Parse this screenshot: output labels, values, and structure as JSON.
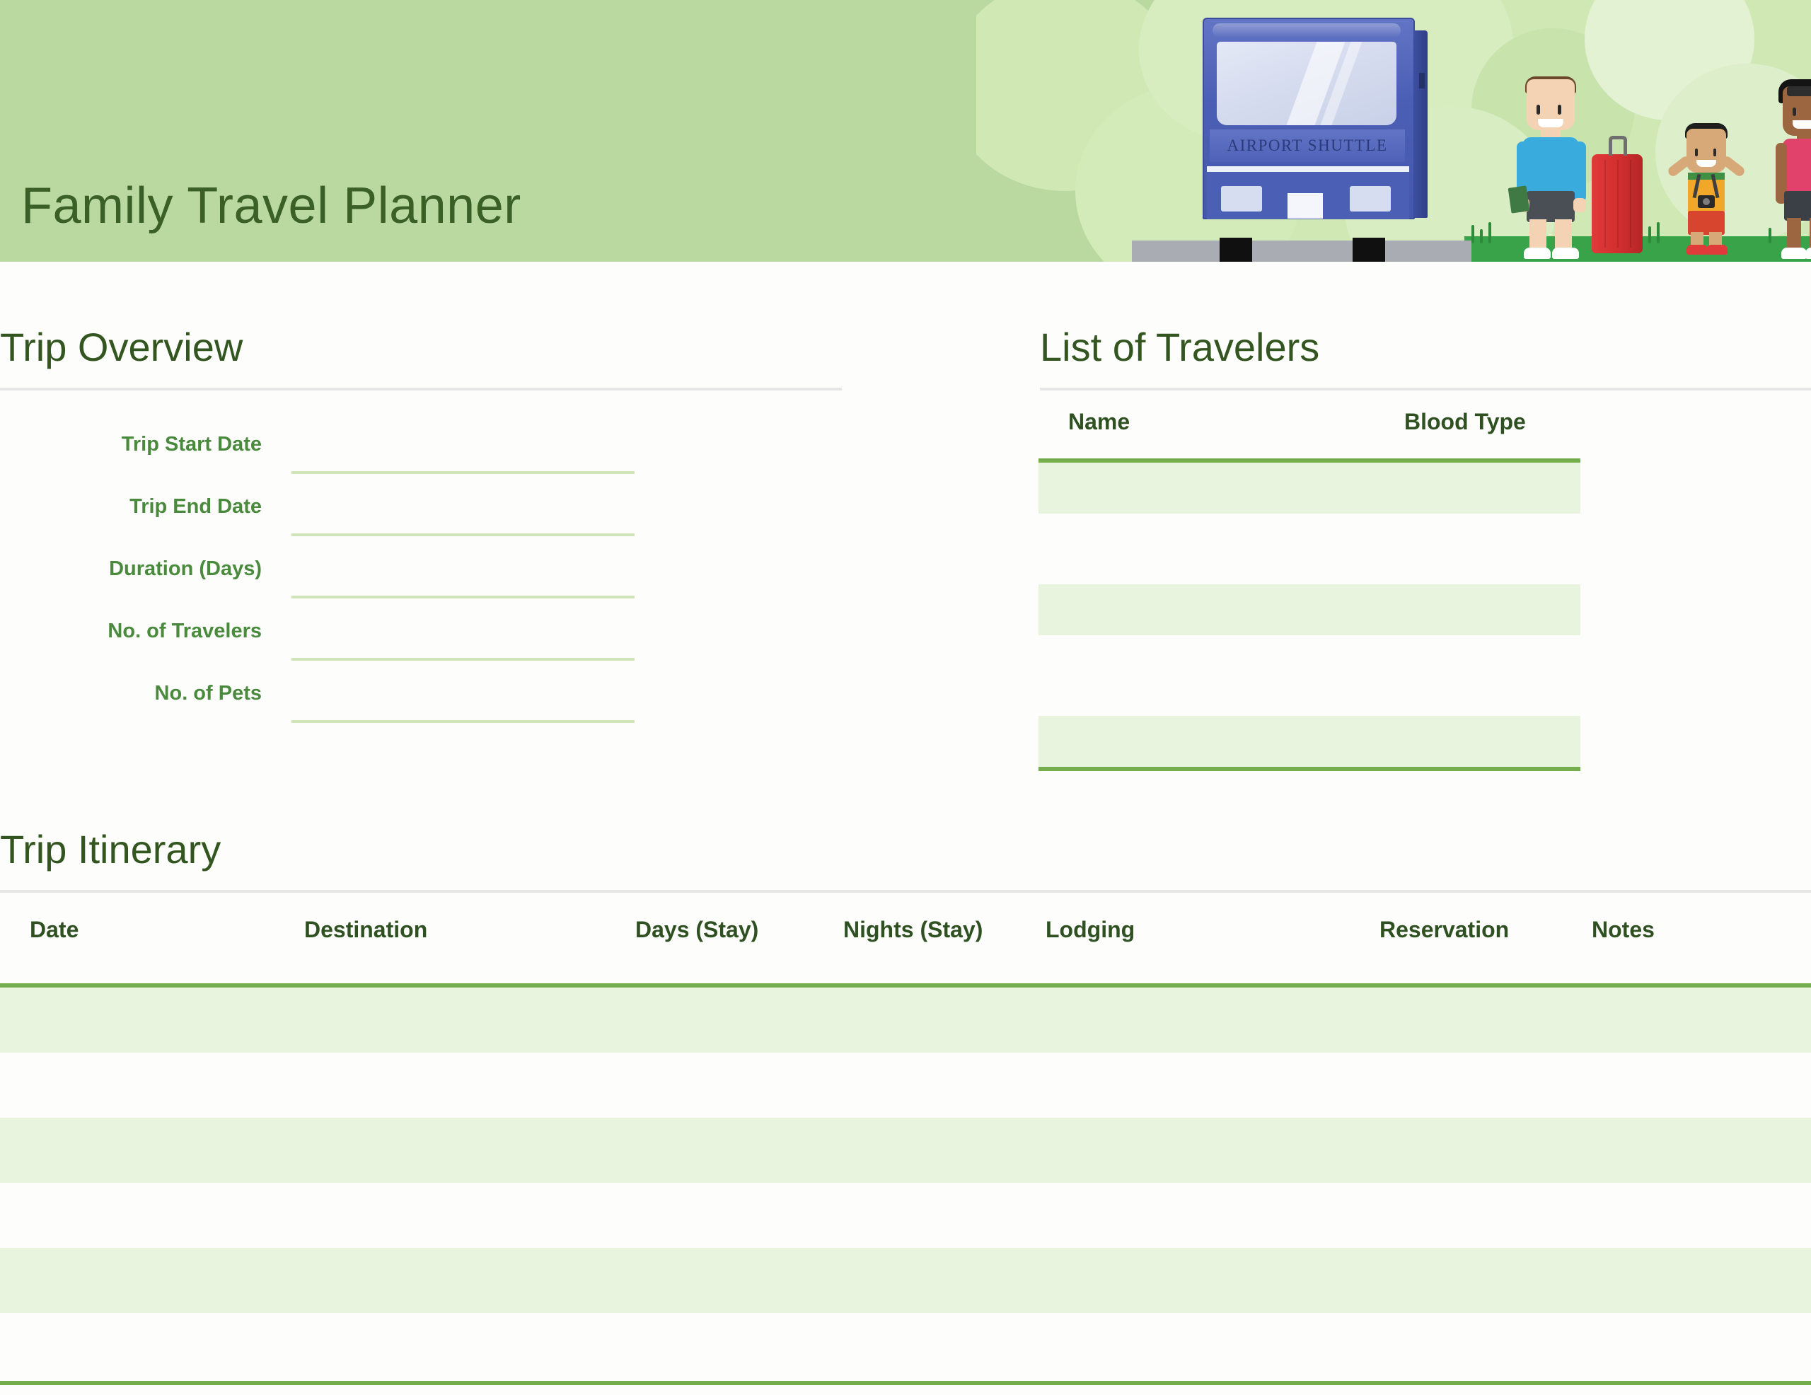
{
  "header": {
    "title": "Family Travel Planner",
    "illustration": {
      "bus_sign": "AIRPORT SHUTTLE",
      "scene": "family-at-airport-shuttle-illustration"
    },
    "band_color": "#b9d9a0",
    "title_color": "#3a5f27"
  },
  "trip_overview": {
    "title": "Trip Overview",
    "fields": [
      {
        "label": "Trip Start Date",
        "value": ""
      },
      {
        "label": "Trip End Date",
        "value": ""
      },
      {
        "label": "Duration (Days)",
        "value": ""
      },
      {
        "label": "No. of Travelers",
        "value": ""
      },
      {
        "label": "No. of Pets",
        "value": ""
      }
    ],
    "label_color": "#4a8a3c",
    "line_color": "#cfe2b8"
  },
  "travelers": {
    "title": "List of Travelers",
    "columns": [
      "Name",
      "Blood Type"
    ],
    "rows": [
      {
        "name": "",
        "blood_type": ""
      },
      {
        "name": "",
        "blood_type": ""
      },
      {
        "name": "",
        "blood_type": ""
      }
    ],
    "accent_color": "#74ad4c",
    "cell_fill": "#e8f4dd"
  },
  "itinerary": {
    "title": "Trip Itinerary",
    "columns": [
      "Date",
      "Destination",
      "Days (Stay)",
      "Nights (Stay)",
      "Lodging",
      "Reservation",
      "Notes"
    ],
    "rows": [
      {
        "date": "",
        "destination": "",
        "days": "",
        "nights": "",
        "lodging": "",
        "reservation": "",
        "notes": ""
      },
      {
        "date": "",
        "destination": "",
        "days": "",
        "nights": "",
        "lodging": "",
        "reservation": "",
        "notes": ""
      },
      {
        "date": "",
        "destination": "",
        "days": "",
        "nights": "",
        "lodging": "",
        "reservation": "",
        "notes": ""
      },
      {
        "date": "",
        "destination": "",
        "days": "",
        "nights": "",
        "lodging": "",
        "reservation": "",
        "notes": ""
      },
      {
        "date": "",
        "destination": "",
        "days": "",
        "nights": "",
        "lodging": "",
        "reservation": "",
        "notes": ""
      },
      {
        "date": "",
        "destination": "",
        "days": "",
        "nights": "",
        "lodging": "",
        "reservation": "",
        "notes": ""
      }
    ],
    "accent_color": "#74ad4c",
    "row_fill": "#e8f4dd"
  }
}
